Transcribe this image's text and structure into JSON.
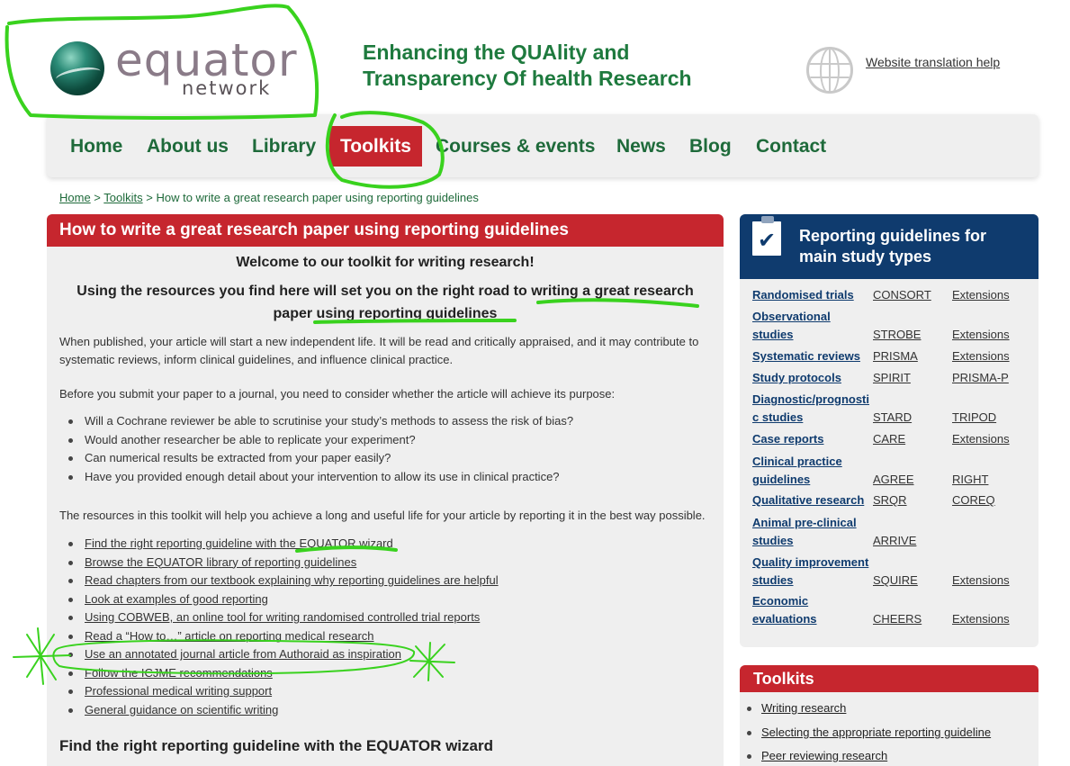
{
  "header": {
    "logo_word": "equator",
    "logo_sub": "network",
    "tagline_line1": "Enhancing the QUAlity and",
    "tagline_line2": "Transparency Of health Research",
    "translation_link": "Website translation help"
  },
  "nav": {
    "items": [
      "Home",
      "About us",
      "Library",
      "Toolkits",
      "Courses & events",
      "News",
      "Blog",
      "Contact"
    ],
    "active": "Toolkits"
  },
  "breadcrumb": {
    "home": "Home",
    "toolkits": "Toolkits",
    "current": "How to write a great research paper using reporting guidelines"
  },
  "main": {
    "title": "How to write a great research paper using reporting guidelines",
    "welcome": "Welcome to our toolkit for writing research!",
    "intro_line1": "Using the resources you find here will set you on the right road to writing a great research",
    "intro_line2": "paper using reporting guidelines",
    "para1_line1": "When published, your article will start a new independent life. It will be read and critically appraised, and it may contribute to",
    "para1_line2": "systematic reviews, inform clinical guidelines, and influence clinical practice.",
    "para2": "Before you submit your paper to a journal, you need to consider whether the article will achieve its purpose:",
    "questions": [
      "Will a Cochrane reviewer be able to scrutinise your study’s methods to assess the risk of bias?",
      "Would another researcher be able to replicate your experiment?",
      "Can numerical results be extracted from your paper easily?",
      "Have you provided enough detail about your intervention to allow its use in clinical practice?"
    ],
    "para3": "The resources in this toolkit will help you achieve a long and useful life for your article by reporting it in the best way possible.",
    "resources": [
      "Find the right reporting guideline with the EQUATOR wizard",
      "Browse the EQUATOR library of reporting guidelines",
      "Read chapters from our textbook explaining why reporting guidelines are helpful",
      "Look at examples of good reporting",
      "Using COBWEB, an online tool for writing randomised controlled trial reports",
      "Read a “How to…” article on reporting medical research",
      "Use an annotated journal article from Authoraid as inspiration",
      "Follow the ICJME recommendations",
      "Professional medical writing support",
      "General guidance on scientific writing"
    ],
    "subheading": "Find the right reporting guideline with the EQUATOR wizard"
  },
  "sidebar_guidelines": {
    "title_line1": "Reporting guidelines for",
    "title_line2": "main study types",
    "rows": [
      {
        "type1": "Randomised trials",
        "type2": "",
        "g1": "CONSORT",
        "g2": "Extensions"
      },
      {
        "type1": "Observational",
        "type2": "studies",
        "g1": "STROBE",
        "g2": "Extensions"
      },
      {
        "type1": "Systematic reviews",
        "type2": "",
        "g1": "PRISMA",
        "g2": "Extensions"
      },
      {
        "type1": "Study protocols",
        "type2": "",
        "g1": "SPIRIT",
        "g2": "PRISMA-P"
      },
      {
        "type1": "Diagnostic/prognosti",
        "type2": "c studies",
        "g1": "STARD",
        "g2": "TRIPOD"
      },
      {
        "type1": "Case reports",
        "type2": "",
        "g1": "CARE",
        "g2": "Extensions"
      },
      {
        "type1": "Clinical practice",
        "type2": "guidelines",
        "g1": "AGREE",
        "g2": "RIGHT"
      },
      {
        "type1": "Qualitative research",
        "type2": "",
        "g1": "SRQR",
        "g2": "COREQ"
      },
      {
        "type1": "Animal pre-clinical",
        "type2": "studies",
        "g1": "ARRIVE",
        "g2": ""
      },
      {
        "type1": "Quality improvement",
        "type2": "studies",
        "g1": "SQUIRE",
        "g2": "Extensions"
      },
      {
        "type1": "Economic",
        "type2": "evaluations",
        "g1": "CHEERS",
        "g2": "Extensions"
      }
    ]
  },
  "sidebar_toolkits": {
    "title": "Toolkits",
    "items": [
      "Writing research",
      "Selecting the appropriate reporting guideline",
      "Peer reviewing research"
    ]
  },
  "colors": {
    "accent_red": "#c6262e",
    "nav_green": "#1e6a3a",
    "tagline_green": "#1e7a3e",
    "sidebar_navy": "#0f3b6e",
    "annotation_green": "#39d21e"
  }
}
